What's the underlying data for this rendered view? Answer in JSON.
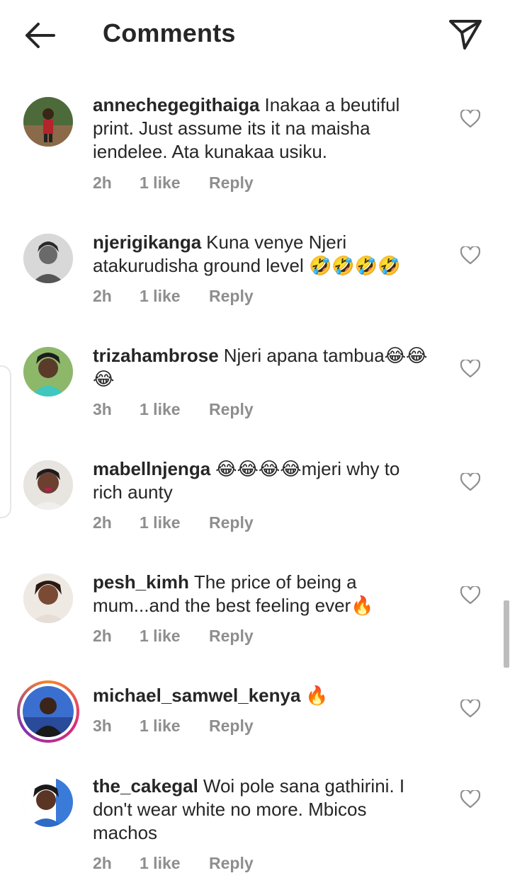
{
  "header": {
    "title": "Comments"
  },
  "icons": {
    "back": "arrow-left-icon",
    "share": "paper-plane-icon",
    "like": "heart-icon"
  },
  "comments": [
    {
      "username": "annechegegithaiga",
      "text": "Inakaa a beutiful print. Just assume its it  na maisha iendelee. Ata kunakaa usiku.",
      "time": "2h",
      "likes": "1 like",
      "reply": "Reply"
    },
    {
      "username": "njerigikanga",
      "text": "Kuna venye Njeri atakurudisha ground level 🤣🤣🤣🤣",
      "time": "2h",
      "likes": "1 like",
      "reply": "Reply"
    },
    {
      "username": "trizahambrose",
      "text": "Njeri apana tambua😂😂😂",
      "time": "3h",
      "likes": "1 like",
      "reply": "Reply"
    },
    {
      "username": "mabellnjenga",
      "text": "😂😂😂😂mjeri why to rich aunty",
      "time": "2h",
      "likes": "1 like",
      "reply": "Reply"
    },
    {
      "username": "pesh_kimh",
      "text": "The price of being a mum...and the best feeling ever🔥",
      "time": "2h",
      "likes": "1 like",
      "reply": "Reply"
    },
    {
      "username": "michael_samwel_kenya",
      "text": "🔥",
      "time": "3h",
      "likes": "1 like",
      "reply": "Reply"
    },
    {
      "username": "the_cakegal",
      "text": "Woi pole sana gathirini. I don't wear white no more. Mbicos machos",
      "time": "2h",
      "likes": "1 like",
      "reply": "Reply"
    }
  ],
  "colors": {
    "text": "#262626",
    "muted": "#8e8e8e",
    "story_ring": "#dd2a7b"
  }
}
